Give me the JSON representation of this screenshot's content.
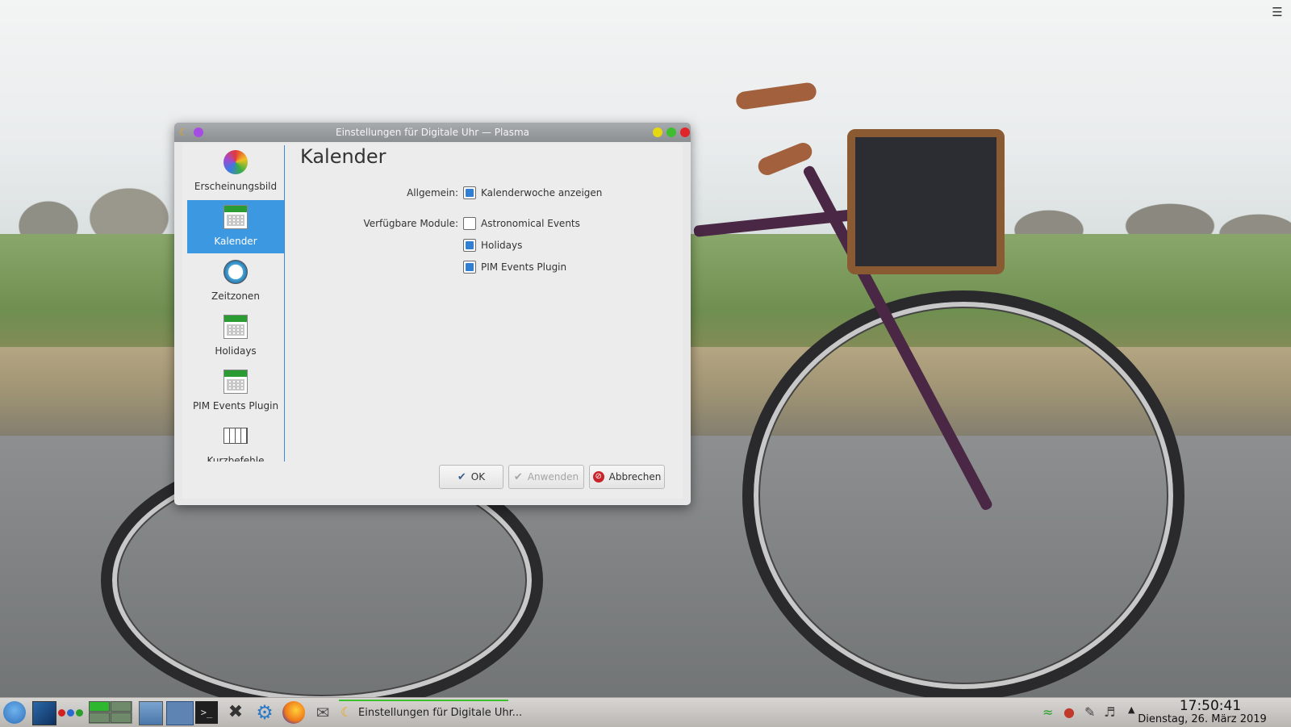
{
  "window": {
    "title": "Einstellungen für Digitale Uhr — Plasma"
  },
  "sidebar": {
    "items": [
      {
        "label": "Erscheinungsbild",
        "active": false
      },
      {
        "label": "Kalender",
        "active": true
      },
      {
        "label": "Zeitzonen",
        "active": false
      },
      {
        "label": "Holidays",
        "active": false
      },
      {
        "label": "PIM Events Plugin",
        "active": false
      },
      {
        "label": "Kurzbefehle",
        "active": false
      }
    ]
  },
  "page": {
    "title": "Kalender",
    "general_label": "Allgemein:",
    "week_checkbox": {
      "label": "Kalenderwoche anzeigen",
      "checked": true
    },
    "modules_label": "Verfügbare Module:",
    "modules": [
      {
        "label": "Astronomical Events",
        "checked": false
      },
      {
        "label": "Holidays",
        "checked": true
      },
      {
        "label": "PIM Events Plugin",
        "checked": true
      }
    ]
  },
  "buttons": {
    "ok": "OK",
    "apply": "Anwenden",
    "cancel": "Abbrechen"
  },
  "taskbar": {
    "task_label": "Einstellungen für Digitale Uhr...",
    "clock_time": "17:50:41",
    "clock_date": "Dienstag, 26. März 2019"
  },
  "colors": {
    "accent": "#3d98e2",
    "checkbox_fill": "#2f7fd6",
    "close": "#e0262a",
    "maximize": "#3fbf2f",
    "minimize": "#e6d80f"
  }
}
